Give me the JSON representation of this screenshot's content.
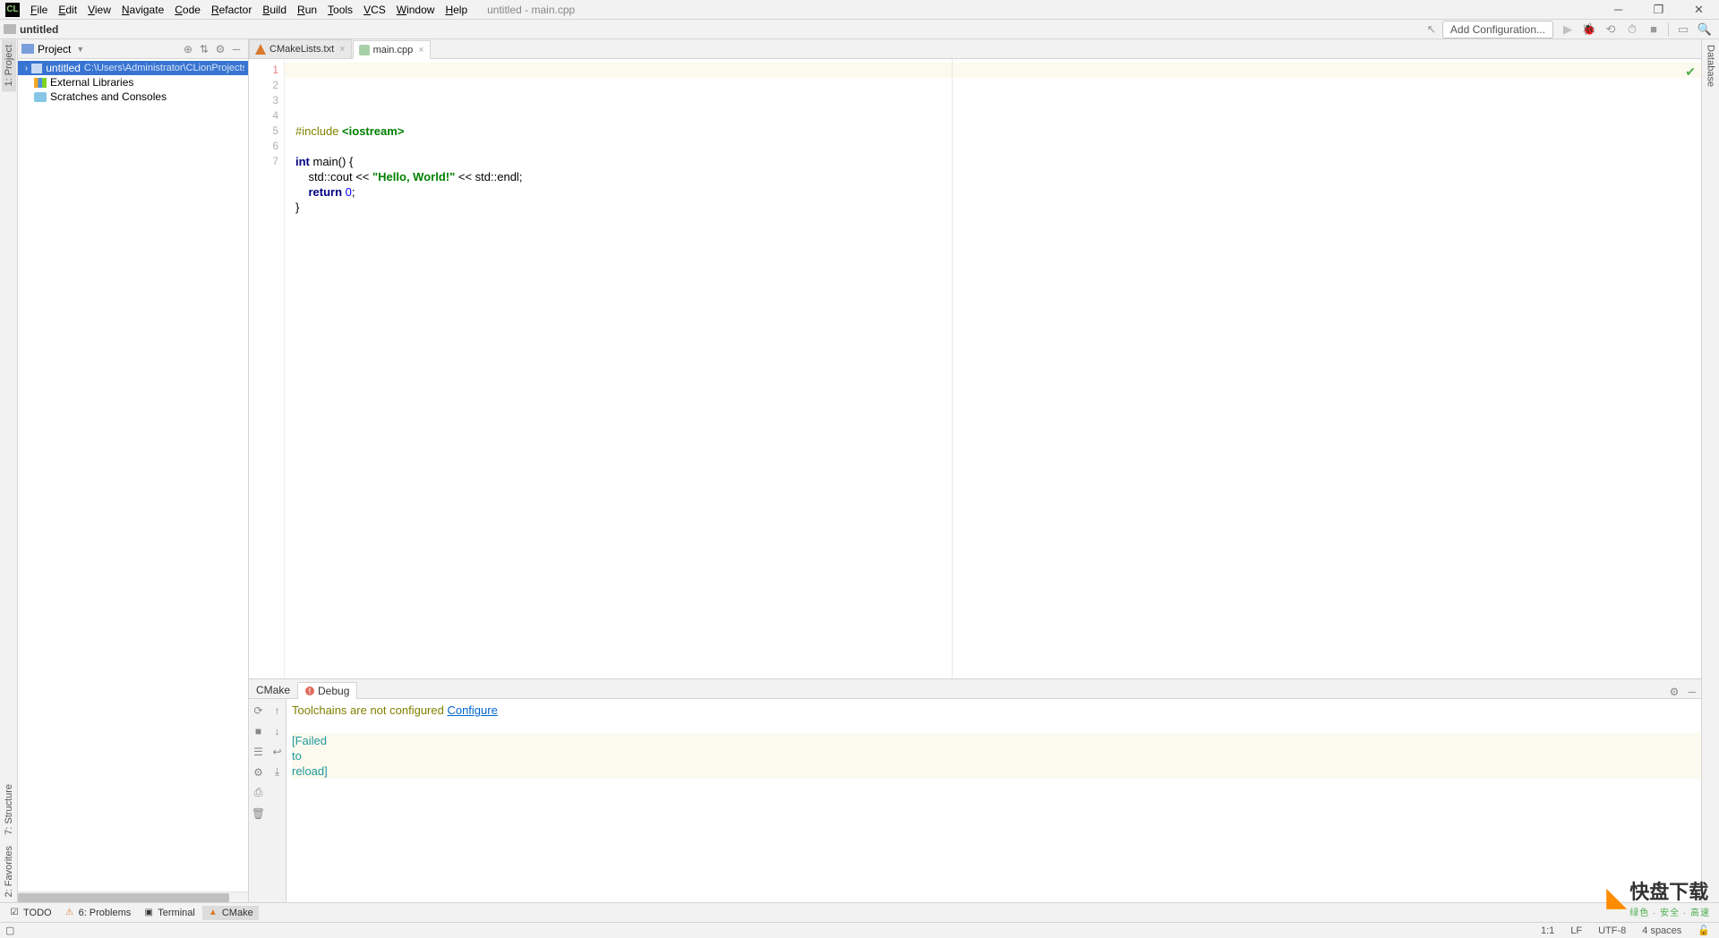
{
  "window": {
    "title": "untitled - main.cpp",
    "menu": [
      "File",
      "Edit",
      "View",
      "Navigate",
      "Code",
      "Refactor",
      "Build",
      "Run",
      "Tools",
      "VCS",
      "Window",
      "Help"
    ]
  },
  "breadcrumb": {
    "label": "untitled"
  },
  "toolbar_right": {
    "add_config": "Add Configuration..."
  },
  "left_strip": {
    "project": "1: Project",
    "structure": "7: Structure",
    "favorites": "2: Favorites"
  },
  "right_strip": {
    "database": "Database"
  },
  "project_panel": {
    "title": "Project",
    "items": [
      {
        "label": "untitled",
        "path": "C:\\Users\\Administrator\\CLionProjects\\unt",
        "selected": true,
        "expandable": true,
        "icon": "folder"
      },
      {
        "label": "External Libraries",
        "icon": "libs"
      },
      {
        "label": "Scratches and Consoles",
        "icon": "scratch"
      }
    ]
  },
  "tabs": [
    {
      "label": "CMakeLists.txt",
      "icon": "cmake",
      "active": false
    },
    {
      "label": "main.cpp",
      "icon": "cpp",
      "active": true
    }
  ],
  "code": {
    "lines": [
      {
        "n": 1,
        "pp": "#include ",
        "inc": "<iostream>"
      },
      {
        "n": 2,
        "blank": true
      },
      {
        "n": 3,
        "kw": "int",
        "rest": " main() {"
      },
      {
        "n": 4,
        "indent": "    std::cout << ",
        "str": "\"Hello, World!\"",
        "rest2": " << std::endl;"
      },
      {
        "n": 5,
        "indent2": "    ",
        "kw2": "return",
        "sp": " ",
        "num": "0",
        "semi": ";"
      },
      {
        "n": 6,
        "brace": "}"
      },
      {
        "n": 7,
        "blank": true
      }
    ]
  },
  "bottom_panel": {
    "tabs": {
      "cmake": "CMake",
      "debug": "Debug"
    },
    "console": {
      "warn_text": "Toolchains are not configured ",
      "configure_link": "Configure",
      "reload_text": "[Failed to reload]"
    }
  },
  "status_tabs": {
    "todo": "TODO",
    "problems": "6: Problems",
    "terminal": "Terminal",
    "cmake": "CMake"
  },
  "statusbar": {
    "pos": "1:1",
    "lineend": "LF",
    "encoding": "UTF-8",
    "indent": "4 spaces"
  },
  "watermark": {
    "main": "快盘下载",
    "sub": "绿色 · 安全 · 高速"
  }
}
